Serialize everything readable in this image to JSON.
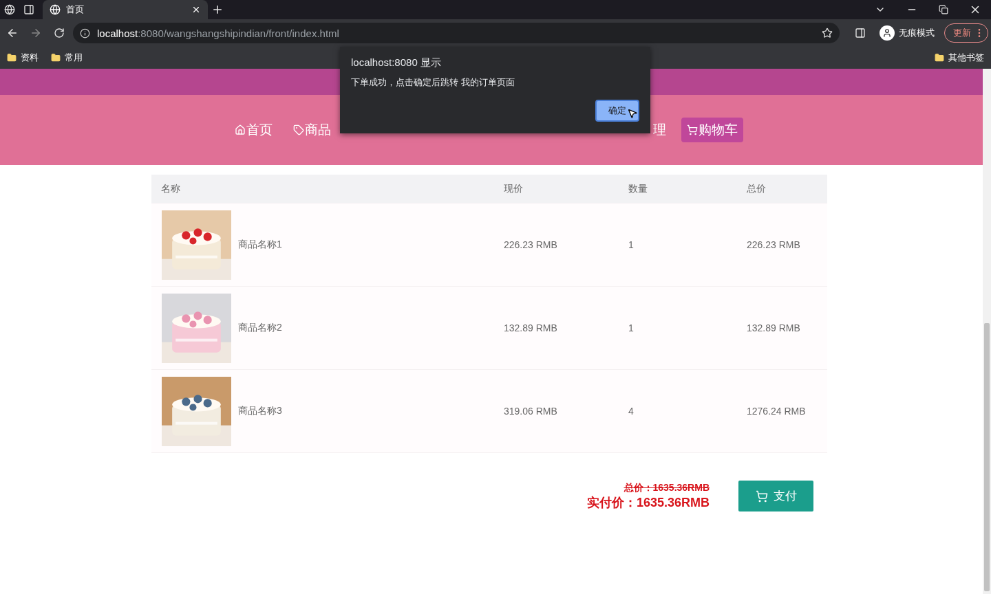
{
  "browser": {
    "tab": {
      "title": "首页"
    },
    "url_host": "localhost",
    "url_path": ":8080/wangshangshipindian/front/index.html",
    "profile": "无痕模式",
    "update_button": "更新",
    "bookmarks": [
      "资料",
      "常用"
    ],
    "other_bookmarks": "其他书签"
  },
  "nav": [
    {
      "label": "首页",
      "selected": false
    },
    {
      "label": "商品",
      "selected": false
    },
    {
      "label": "理",
      "selected": false
    },
    {
      "label": "购物车",
      "selected": true
    }
  ],
  "table": {
    "columns": [
      "名称",
      "现价",
      "数量",
      "总价"
    ],
    "rows": [
      {
        "name": "商品名称1",
        "price": "226.23 RMB",
        "quantity": "1",
        "total": "226.23 RMB"
      },
      {
        "name": "商品名称2",
        "price": "132.89 RMB",
        "quantity": "1",
        "total": "132.89 RMB"
      },
      {
        "name": "商品名称3",
        "price": "319.06 RMB",
        "quantity": "4",
        "total": "1276.24 RMB"
      }
    ]
  },
  "summary": {
    "total": "总价：1635.36RMB",
    "paid": "实付价：1635.36RMB",
    "pay_button": "支付"
  },
  "dialog": {
    "title": "localhost:8080 显示",
    "message": "下单成功，点击确定后跳转 我的订单页面",
    "ok_button": "确定"
  }
}
